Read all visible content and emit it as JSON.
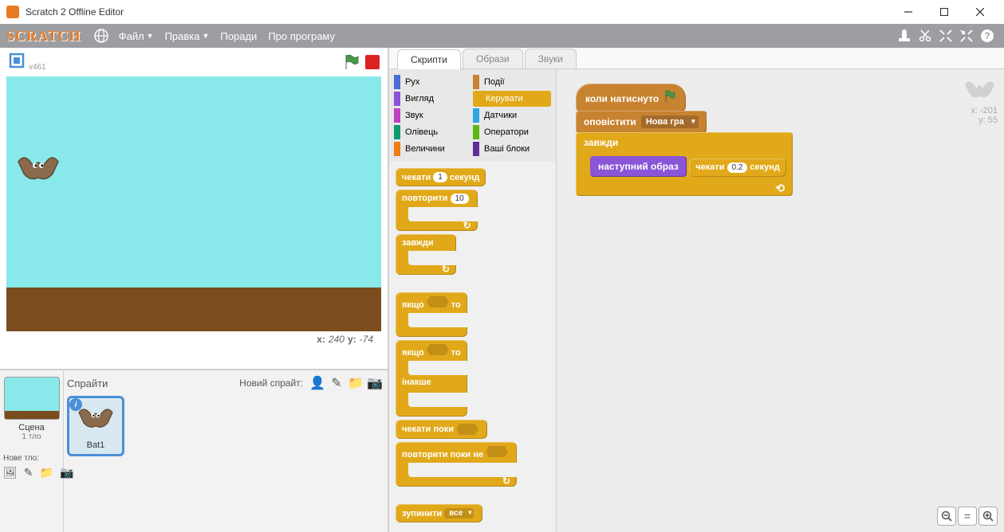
{
  "window": {
    "title": "Scratch 2 Offline Editor"
  },
  "menu": {
    "file": "Файл",
    "edit": "Правка",
    "tips": "Поради",
    "about": "Про програму"
  },
  "stage": {
    "title_code": "v461",
    "coords": {
      "x_label": "x:",
      "x_val": "240",
      "y_label": "y:",
      "y_val": "-74"
    }
  },
  "sprites": {
    "panel_title": "Спрайти",
    "new_sprite_label": "Новий спрайт:",
    "backdrop": {
      "label": "Сцена",
      "sub": "1 тло",
      "new_label": "Нове тло:"
    },
    "items": [
      {
        "name": "Bat1"
      }
    ]
  },
  "tabs": {
    "scripts": "Скрипти",
    "costumes": "Образи",
    "sounds": "Звуки"
  },
  "categories": {
    "motion": "Рух",
    "looks": "Вигляд",
    "sound": "Звук",
    "pen": "Олівець",
    "data": "Величини",
    "events": "Події",
    "control": "Керувати",
    "sensing": "Датчики",
    "operators": "Оператори",
    "more": "Ваші блоки"
  },
  "palette_blocks": {
    "wait": "чекати",
    "seconds": "секунд",
    "wait_val": "1",
    "repeat": "повторити",
    "repeat_val": "10",
    "forever": "завжди",
    "if": "якщо",
    "then": "то",
    "else": "інакше",
    "wait_until": "чекати поки",
    "repeat_until": "повторити поки не",
    "stop": "зупинити",
    "stop_opt": "все"
  },
  "script": {
    "when_clicked": "коли натиснуто",
    "broadcast": "оповістити",
    "broadcast_msg": "Нова гра",
    "forever": "завжди",
    "next_costume": "наступний образ",
    "wait": "чекати",
    "wait_val": "0.2",
    "seconds": "секунд"
  },
  "sprite_corner": {
    "x_label": "x:",
    "x_val": "-201",
    "y_label": "y:",
    "y_val": "55"
  }
}
